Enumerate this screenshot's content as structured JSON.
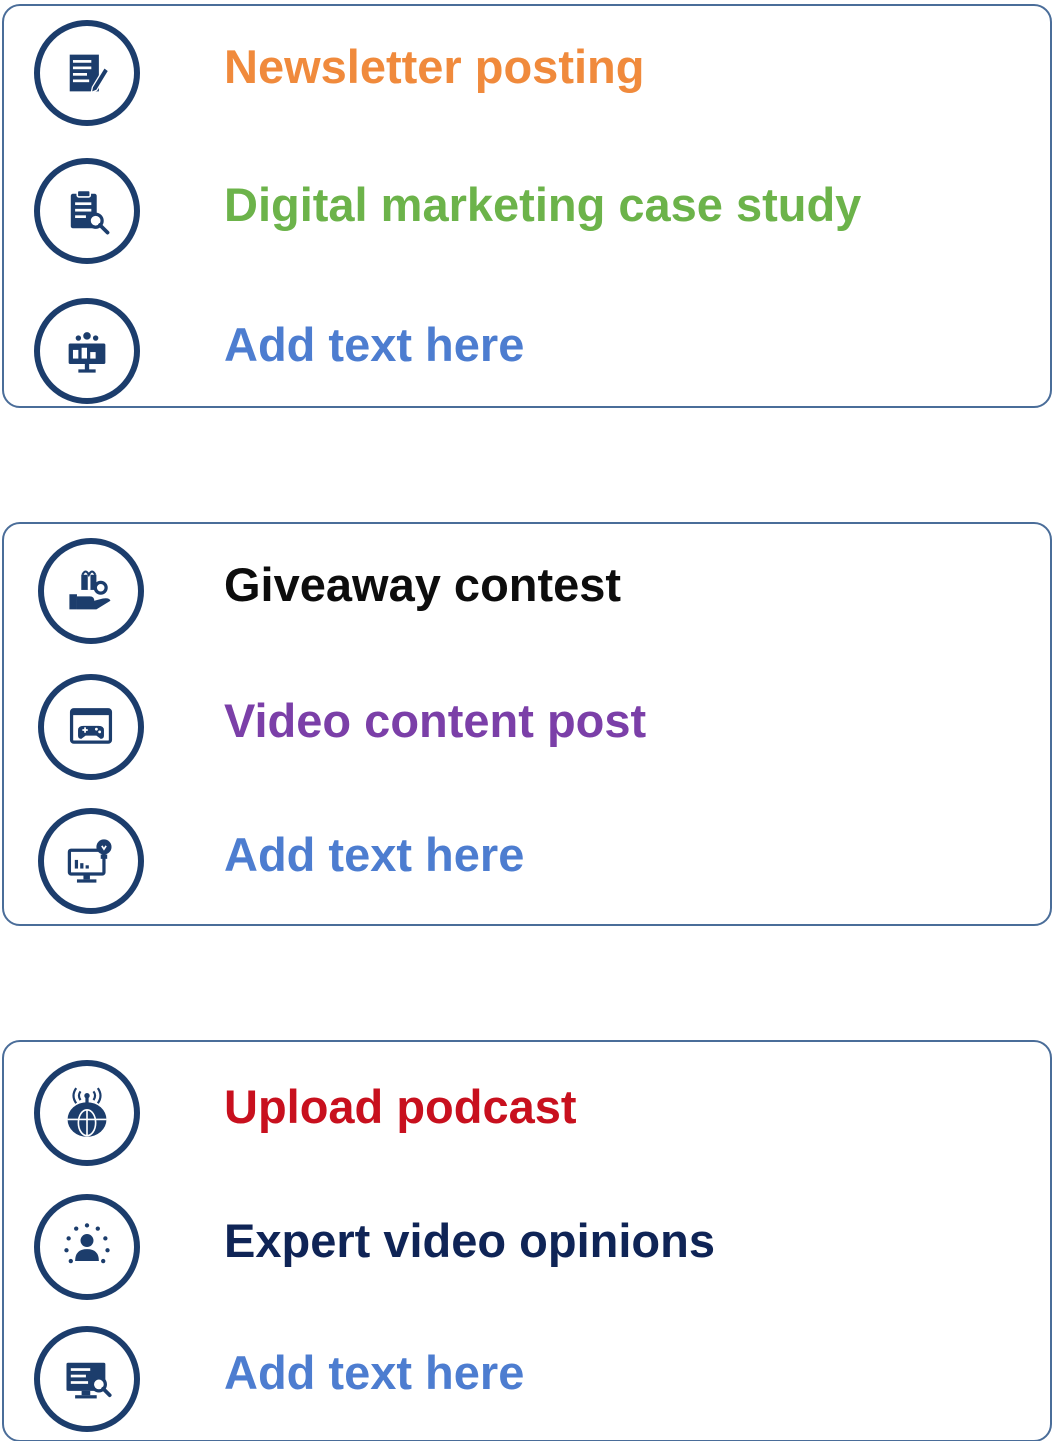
{
  "groups": [
    {
      "items": [
        {
          "label": "Newsletter posting",
          "color": "#f08a3c",
          "icon": "newsletter-icon"
        },
        {
          "label": "Digital marketing case study",
          "color": "#6cb34a",
          "icon": "case-study-icon"
        },
        {
          "label": "Add text here",
          "color": "#4d7dd0",
          "icon": "presentation-icon"
        }
      ]
    },
    {
      "items": [
        {
          "label": "Giveaway contest",
          "color": "#0d0d0d",
          "icon": "giveaway-icon"
        },
        {
          "label": "Video content post",
          "color": "#7b3fa8",
          "icon": "video-game-icon"
        },
        {
          "label": "Add text here",
          "color": "#4d7dd0",
          "icon": "monitor-idea-icon"
        }
      ]
    },
    {
      "items": [
        {
          "label": "Upload podcast",
          "color": "#c8101e",
          "icon": "podcast-globe-icon"
        },
        {
          "label": "Expert video opinions",
          "color": "#0f2456",
          "icon": "expert-network-icon"
        },
        {
          "label": "Add text here",
          "color": "#4d7dd0",
          "icon": "screen-search-icon"
        }
      ]
    }
  ]
}
